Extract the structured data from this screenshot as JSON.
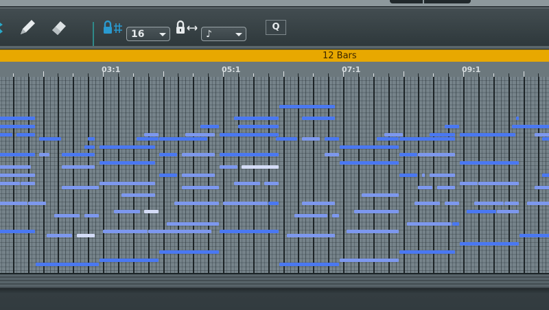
{
  "toolbar": {
    "icons": [
      "select-icon",
      "pencil-icon",
      "eraser-icon",
      "lock-grid-icon",
      "grid-hash-icon",
      "lock-length-icon",
      "length-arrows-icon"
    ],
    "grid_dropdown": {
      "value": "16"
    },
    "length_dropdown": {
      "value": "♪"
    },
    "quantize_button": "Q"
  },
  "clip_bar": {
    "label": "12 Bars",
    "color": "#e8a800"
  },
  "ruler": {
    "labels": [
      "03:1",
      "05:1",
      "07:1",
      "09:1"
    ]
  },
  "colors": {
    "note_bright": "#4a78f2",
    "note_mid": "#7d98ee",
    "note_pale": "#d4dcf6",
    "grid_bg": "#76838a"
  },
  "notes_legend": "each note: [row from top, start beat, end beat, shade 0=bright 1=mid 2=pale]",
  "notes": [
    [
      0,
      19.75,
      23.5,
      0
    ],
    [
      3,
      1,
      3.5,
      0
    ],
    [
      3,
      16.75,
      19.75,
      0
    ],
    [
      3,
      21.25,
      23.5,
      0
    ],
    [
      3,
      35.5,
      35.75,
      0
    ],
    [
      5,
      1,
      3.5,
      0
    ],
    [
      5,
      14.5,
      15.75,
      0
    ],
    [
      5,
      17,
      19.75,
      0
    ],
    [
      5,
      30.75,
      31.75,
      0
    ],
    [
      5,
      35.25,
      38,
      0
    ],
    [
      7,
      1,
      2,
      0
    ],
    [
      7,
      2.25,
      3.5,
      0
    ],
    [
      7,
      10.75,
      11.75,
      1
    ],
    [
      7,
      13.5,
      15.5,
      1
    ],
    [
      7,
      15.75,
      19.75,
      0
    ],
    [
      7,
      26.75,
      28,
      1
    ],
    [
      7,
      29.75,
      31.5,
      0
    ],
    [
      7,
      31.75,
      35.5,
      0
    ],
    [
      7,
      36.75,
      38,
      1
    ],
    [
      8,
      3.75,
      5.25,
      0
    ],
    [
      8,
      7,
      7.5,
      0
    ],
    [
      8,
      10.25,
      11.75,
      0
    ],
    [
      8,
      11.75,
      15,
      0
    ],
    [
      8,
      19.5,
      21,
      0
    ],
    [
      8,
      21.25,
      22.5,
      1
    ],
    [
      8,
      22.75,
      23.75,
      0
    ],
    [
      8,
      26.25,
      27.75,
      0
    ],
    [
      8,
      27.75,
      31.5,
      0
    ],
    [
      8,
      37.25,
      38,
      0
    ],
    [
      10,
      6.75,
      7.5,
      0
    ],
    [
      10,
      7.75,
      11.5,
      0
    ],
    [
      10,
      23.75,
      27.75,
      0
    ],
    [
      12,
      1,
      3.5,
      0
    ],
    [
      12,
      3.75,
      4.5,
      1
    ],
    [
      12,
      5.25,
      7.5,
      0
    ],
    [
      12,
      11.75,
      13,
      0
    ],
    [
      12,
      13.25,
      15.5,
      1
    ],
    [
      12,
      15.75,
      19.75,
      0
    ],
    [
      12,
      22.75,
      23.75,
      1
    ],
    [
      12,
      27.75,
      29,
      0
    ],
    [
      12,
      29,
      31.5,
      1
    ],
    [
      14,
      7.75,
      11.5,
      0
    ],
    [
      14,
      23.75,
      27.75,
      0
    ],
    [
      14,
      31.75,
      35.75,
      0
    ],
    [
      15,
      1,
      3.25,
      1
    ],
    [
      15,
      5.25,
      7.5,
      1
    ],
    [
      15,
      15.75,
      17,
      1
    ],
    [
      15,
      17.25,
      19.75,
      2
    ],
    [
      17,
      1,
      3.5,
      1
    ],
    [
      17,
      11.75,
      13,
      0
    ],
    [
      17,
      13.25,
      15.5,
      1
    ],
    [
      17,
      27.75,
      29,
      0
    ],
    [
      17,
      29.25,
      29.5,
      1
    ],
    [
      17,
      29.75,
      31.5,
      1
    ],
    [
      17,
      37.25,
      38,
      0
    ],
    [
      19,
      1,
      2.5,
      1
    ],
    [
      19,
      2.5,
      3.5,
      1
    ],
    [
      19,
      7.75,
      11.5,
      1
    ],
    [
      19,
      16.75,
      18.5,
      1
    ],
    [
      19,
      18.75,
      19.75,
      1
    ],
    [
      19,
      31.75,
      33,
      1
    ],
    [
      19,
      33,
      35.75,
      1
    ],
    [
      20,
      5.25,
      7.75,
      1
    ],
    [
      20,
      13.25,
      15.75,
      1
    ],
    [
      20,
      29,
      30,
      1
    ],
    [
      20,
      30.25,
      31.5,
      1
    ],
    [
      20,
      36.75,
      38,
      1
    ],
    [
      22,
      9.25,
      11.5,
      1
    ],
    [
      22,
      25.25,
      27.75,
      1
    ],
    [
      24,
      1,
      3,
      1
    ],
    [
      24,
      3,
      4.25,
      1
    ],
    [
      24,
      12.75,
      15.75,
      1
    ],
    [
      24,
      16,
      19,
      1
    ],
    [
      24,
      19,
      19.75,
      0
    ],
    [
      24,
      21.25,
      23.5,
      1
    ],
    [
      24,
      28.75,
      30.5,
      1
    ],
    [
      24,
      30.75,
      31.75,
      1
    ],
    [
      24,
      32.75,
      34.75,
      1
    ],
    [
      24,
      34.75,
      35.75,
      1
    ],
    [
      24,
      36.25,
      38,
      1
    ],
    [
      26,
      8.75,
      10.5,
      1
    ],
    [
      26,
      10.75,
      11.75,
      2
    ],
    [
      26,
      24.75,
      27.75,
      1
    ],
    [
      26,
      32.25,
      34.25,
      0
    ],
    [
      26,
      34.25,
      35.75,
      1
    ],
    [
      27,
      4.75,
      6.5,
      1
    ],
    [
      27,
      6.75,
      7.75,
      1
    ],
    [
      27,
      20.75,
      23,
      1
    ],
    [
      27,
      23.25,
      23.75,
      1
    ],
    [
      29,
      12.25,
      15.75,
      1
    ],
    [
      29,
      28.25,
      31.25,
      1
    ],
    [
      29,
      31.25,
      31.75,
      0
    ],
    [
      31,
      1,
      3.5,
      0
    ],
    [
      31,
      8,
      11,
      1
    ],
    [
      31,
      11,
      15.25,
      1
    ],
    [
      31,
      15.75,
      19.75,
      0
    ],
    [
      31,
      24.25,
      27.75,
      1
    ],
    [
      32,
      4.25,
      6,
      1
    ],
    [
      32,
      6.25,
      7.5,
      2
    ],
    [
      32,
      20.25,
      23.5,
      1
    ],
    [
      32,
      35.75,
      38,
      0
    ],
    [
      34,
      31.75,
      35.75,
      0
    ],
    [
      36,
      11.75,
      15.75,
      0
    ],
    [
      36,
      27.75,
      31.5,
      0
    ],
    [
      38,
      7.75,
      11.75,
      0
    ],
    [
      38,
      23.75,
      27.75,
      1
    ],
    [
      39,
      3.5,
      7.75,
      0
    ],
    [
      39,
      19.75,
      23.75,
      0
    ]
  ]
}
